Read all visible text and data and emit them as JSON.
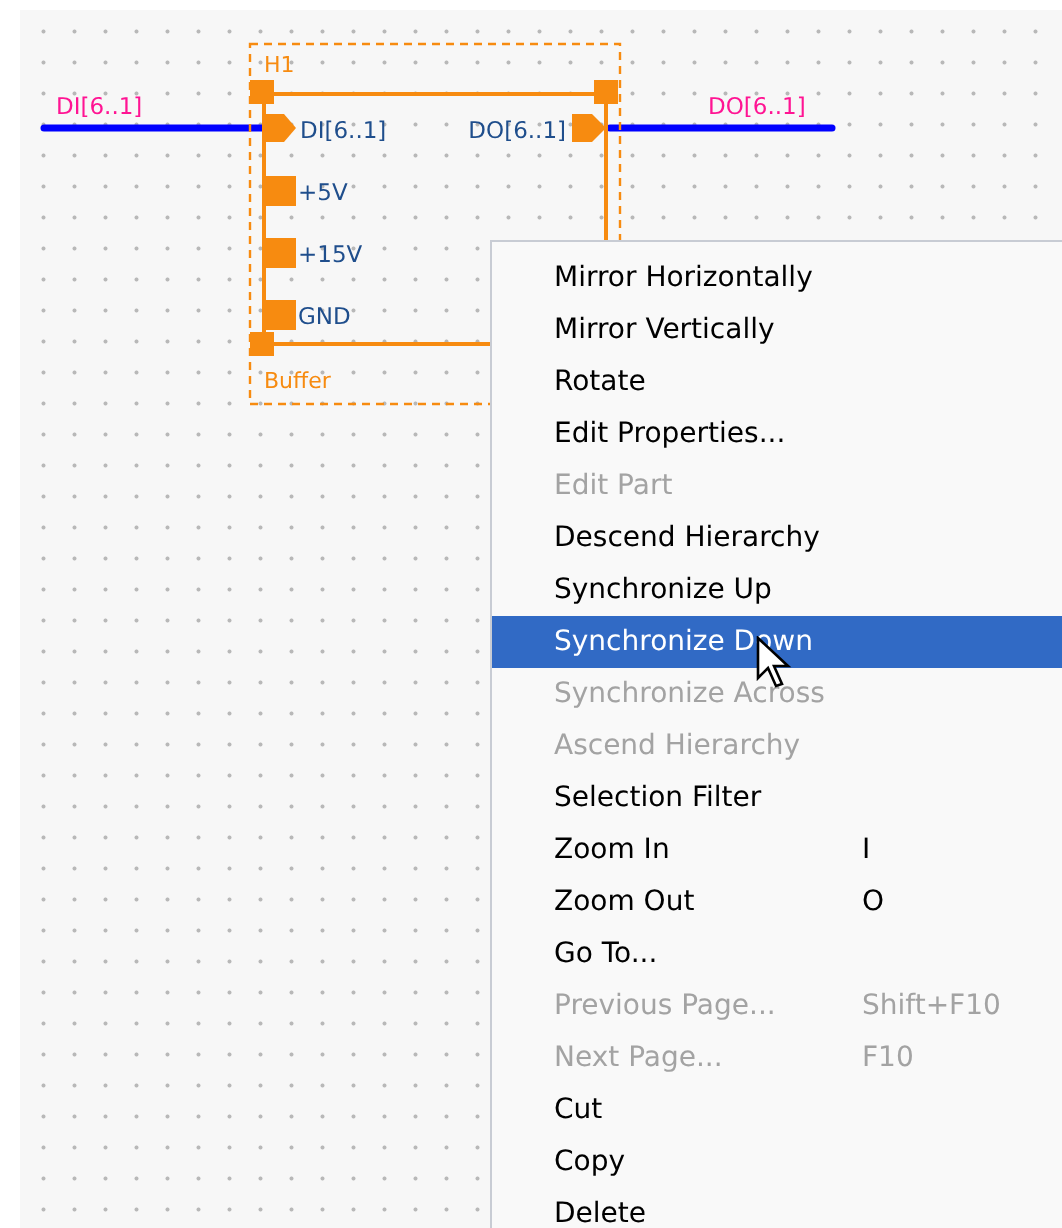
{
  "schematic": {
    "nets": [
      {
        "label": "DI[6..1]",
        "kind": "input"
      },
      {
        "label": "DO[6..1]",
        "kind": "output"
      }
    ],
    "part": {
      "reference": "H1",
      "name": "Buffer",
      "selected": true,
      "pins": [
        {
          "name": "DI[6..1]",
          "kind": "input"
        },
        {
          "name": "DO[6..1]",
          "kind": "output"
        },
        {
          "name": "+5V",
          "kind": "power"
        },
        {
          "name": "+15V",
          "kind": "power"
        },
        {
          "name": "GND",
          "kind": "power"
        }
      ]
    }
  },
  "context_menu": {
    "items": [
      {
        "label": "Mirror Horizontally",
        "disabled": false,
        "selected": false
      },
      {
        "label": "Mirror Vertically",
        "disabled": false,
        "selected": false
      },
      {
        "label": "Rotate",
        "disabled": false,
        "selected": false
      },
      {
        "label": "Edit Properties...",
        "disabled": false,
        "selected": false
      },
      {
        "label": "Edit Part",
        "disabled": true,
        "selected": false
      },
      {
        "label": "Descend Hierarchy",
        "disabled": false,
        "selected": false
      },
      {
        "label": "Synchronize Up",
        "disabled": false,
        "selected": false
      },
      {
        "label": "Synchronize Down",
        "disabled": false,
        "selected": true
      },
      {
        "label": "Synchronize Across",
        "disabled": true,
        "selected": false
      },
      {
        "label": "Ascend Hierarchy",
        "disabled": true,
        "selected": false
      },
      {
        "label": "Selection Filter",
        "disabled": false,
        "selected": false
      },
      {
        "label": "Zoom In",
        "shortcut": "I",
        "disabled": false,
        "selected": false
      },
      {
        "label": "Zoom Out",
        "shortcut": "O",
        "disabled": false,
        "selected": false
      },
      {
        "label": "Go To...",
        "disabled": false,
        "selected": false
      },
      {
        "label": "Previous Page...",
        "shortcut": "Shift+F10",
        "disabled": true,
        "selected": false
      },
      {
        "label": "Next Page...",
        "shortcut": "F10",
        "disabled": true,
        "selected": false
      },
      {
        "label": "Cut",
        "disabled": false,
        "selected": false
      },
      {
        "label": "Copy",
        "disabled": false,
        "selected": false
      },
      {
        "label": "Delete",
        "disabled": false,
        "selected": false
      }
    ]
  }
}
